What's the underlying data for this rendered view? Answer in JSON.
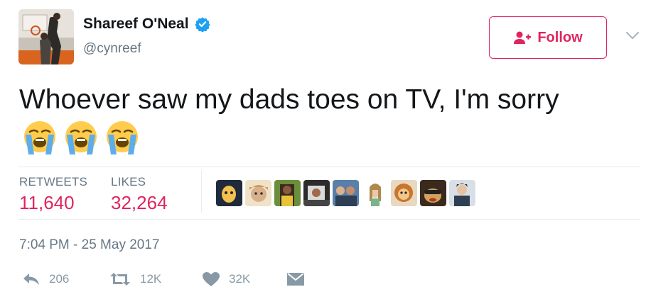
{
  "author": {
    "display_name": "Shareef O'Neal",
    "handle": "@cynreef",
    "verified": true
  },
  "follow_label": "Follow",
  "tweet": {
    "text": "Whoever saw my dads toes on TV, I'm sorry",
    "emojis": [
      "loudly-crying-face",
      "loudly-crying-face",
      "loudly-crying-face"
    ]
  },
  "stats": {
    "retweets_label": "RETWEETS",
    "retweets_value": "11,640",
    "likes_label": "LIKES",
    "likes_value": "32,264"
  },
  "timestamp": "7:04 PM - 25 May 2017",
  "actions": {
    "reply_count": "206",
    "retweet_count": "12K",
    "like_count": "32K"
  },
  "colors": {
    "accent": "#e0245e",
    "verified": "#1da1f2",
    "secondary_text": "#657786",
    "action_icon": "#8899a6",
    "divider": "#e6ecf0"
  }
}
